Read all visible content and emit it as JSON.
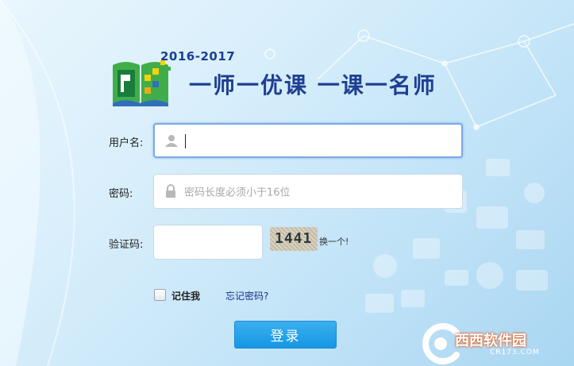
{
  "logo": {
    "year": "2016-2017",
    "slogan": "一师一优课 一课一名师"
  },
  "form": {
    "username": {
      "label": "用户名:",
      "value": ""
    },
    "password": {
      "label": "密码:",
      "placeholder": "密码长度必须小于16位"
    },
    "captcha": {
      "label": "验证码:",
      "value": "",
      "image_text": "1441",
      "refresh_label": "换一个!"
    },
    "remember_label": "记住我",
    "forgot_label": "忘记密码?",
    "login_label": "登录"
  },
  "watermark": {
    "brand": "西西软件园",
    "domain": "CR173.COM"
  },
  "colors": {
    "button": "#1597e4",
    "slogan": "#1f3f93",
    "link": "#1a2e8c"
  }
}
